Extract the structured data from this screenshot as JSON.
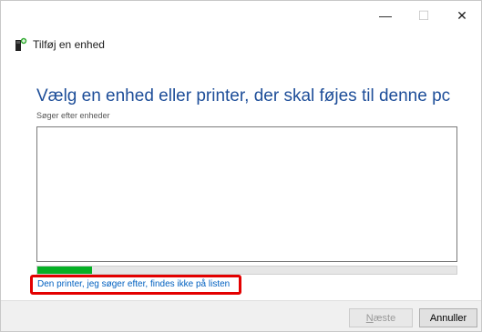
{
  "window": {
    "title": "Tilføj en enhed",
    "controls": {
      "minimize": "—",
      "maximize": "☐",
      "close": "✕"
    }
  },
  "main": {
    "heading": "Vælg en enhed eller printer, der skal føjes til denne pc",
    "subheading": "Søger efter enheder",
    "progress_fraction": 0.13,
    "link_text": "Den printer, jeg søger efter, findes ikke på listen"
  },
  "footer": {
    "next_mnemonic": "N",
    "next_rest": "æste",
    "cancel_label": "Annuller"
  },
  "colors": {
    "heading": "#1e4e99",
    "link": "#0060c0",
    "progress": "#06b025",
    "highlight": "#e30000"
  }
}
